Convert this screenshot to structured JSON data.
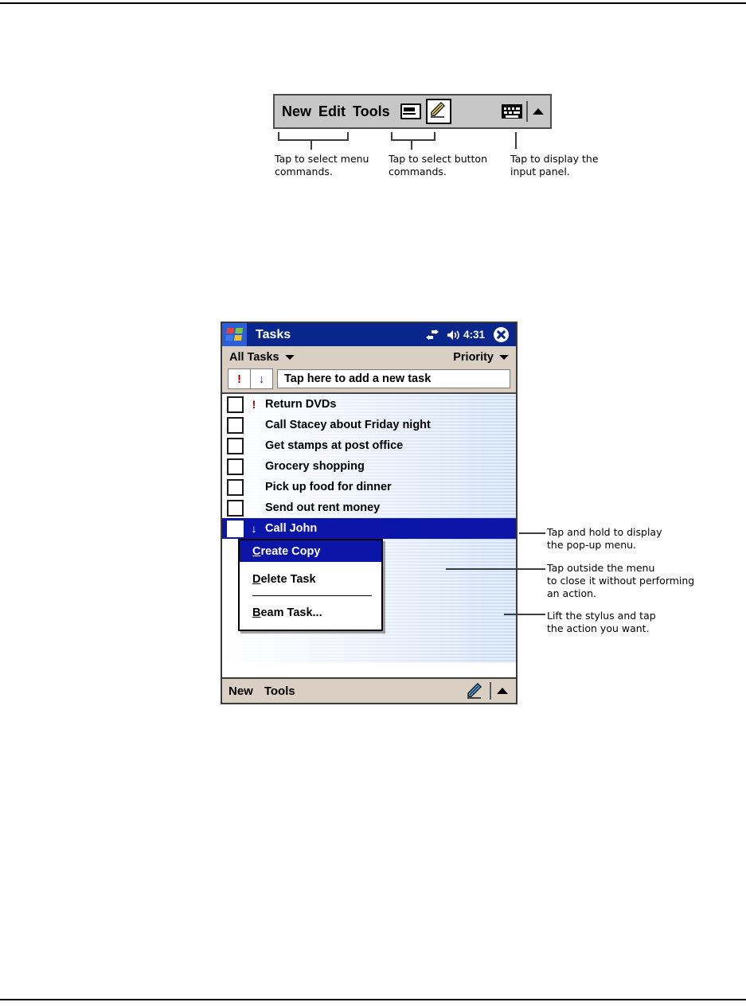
{
  "figure_top": {
    "command_bar": {
      "menus": [
        "New",
        "Edit",
        "Tools"
      ],
      "recorder_icon": "recorder-icon",
      "pencil_icon": "pencil-icon",
      "keyboard_icon": "keyboard-icon",
      "arrow_icon": "chevron-up-icon"
    },
    "callouts": [
      {
        "id": "menu-commands",
        "text": "Tap to select menu\ncommands."
      },
      {
        "id": "button-commands",
        "text": "Tap to select button\ncommands."
      },
      {
        "id": "input-panel",
        "text": "Tap to display the\ninput panel."
      }
    ]
  },
  "pda": {
    "titlebar": {
      "start_icon": "windows-start-icon",
      "title": "Tasks",
      "connectivity_icon": "connectivity-icon",
      "volume_icon": "volume-icon",
      "clock": "4:31",
      "close_icon": "close-icon"
    },
    "filterbar": {
      "filter_label": "All Tasks",
      "filter_caret": "chevron-down-icon",
      "sort_label": "Priority",
      "sort_caret": "chevron-down-icon"
    },
    "addrow": {
      "priority_high_glyph": "!",
      "priority_low_glyph": "↓",
      "new_task_text": "Tap here to add a new task"
    },
    "tasks": [
      {
        "title": "Return DVDs",
        "priority": "high",
        "glyph": "!",
        "checked": false,
        "selected": false
      },
      {
        "title": "Call Stacey about Friday night",
        "priority": "normal",
        "glyph": "",
        "checked": false,
        "selected": false
      },
      {
        "title": "Get stamps at post office",
        "priority": "normal",
        "glyph": "",
        "checked": false,
        "selected": false
      },
      {
        "title": "Grocery shopping",
        "priority": "normal",
        "glyph": "",
        "checked": false,
        "selected": false
      },
      {
        "title": "Pick up food for dinner",
        "priority": "normal",
        "glyph": "",
        "checked": false,
        "selected": false
      },
      {
        "title": "Send out rent money",
        "priority": "normal",
        "glyph": "",
        "checked": false,
        "selected": false
      },
      {
        "title": "Call John",
        "priority": "low",
        "glyph": "↓",
        "checked": false,
        "selected": true
      }
    ],
    "context_menu": {
      "items": [
        {
          "accel": "C",
          "rest": "reate Copy",
          "highlighted": true
        },
        {
          "accel": "D",
          "rest": "elete Task",
          "highlighted": false
        },
        {
          "accel": "B",
          "rest": "eam Task...",
          "highlighted": false
        }
      ]
    },
    "bottombar": {
      "menus": [
        "New",
        "Tools"
      ],
      "pencil_icon": "pencil-icon",
      "arrow_icon": "chevron-up-icon"
    }
  },
  "figure_bottom_callouts": [
    {
      "id": "popup-menu",
      "text": "Tap and hold to display\nthe pop-up menu."
    },
    {
      "id": "close-menu",
      "text": "Tap outside the menu\nto close it without performing\nan action."
    },
    {
      "id": "lift-stylus",
      "text": "Lift the stylus and tap\nthe action you want."
    }
  ],
  "colors": {
    "titlebar_blue": "#08268c",
    "selection_blue": "#0b16a8",
    "chrome_tan": "#d9cfc3",
    "cmdbar_gray": "#c6c6c6",
    "priority_high_red": "#9a0000",
    "priority_low_blue": "#1a1a9e"
  }
}
